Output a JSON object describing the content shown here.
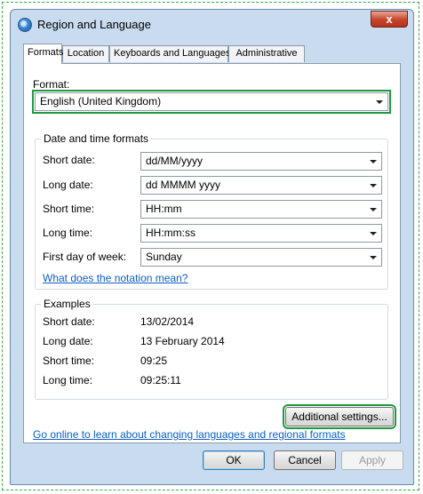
{
  "window": {
    "title": "Region and Language",
    "close_glyph": "x"
  },
  "tabs": [
    {
      "label": "Formats"
    },
    {
      "label": "Location"
    },
    {
      "label": "Keyboards and Languages"
    },
    {
      "label": "Administrative"
    }
  ],
  "format": {
    "label": "Format:",
    "value": "English (United Kingdom)"
  },
  "date_time_formats": {
    "title": "Date and time formats",
    "rows": [
      {
        "label": "Short date:",
        "value": "dd/MM/yyyy"
      },
      {
        "label": "Long date:",
        "value": "dd MMMM yyyy"
      },
      {
        "label": "Short time:",
        "value": "HH:mm"
      },
      {
        "label": "Long time:",
        "value": "HH:mm:ss"
      },
      {
        "label": "First day of week:",
        "value": "Sunday"
      }
    ],
    "notation_link": "What does the notation mean?"
  },
  "examples": {
    "title": "Examples",
    "rows": [
      {
        "label": "Short date:",
        "value": "13/02/2014"
      },
      {
        "label": "Long date:",
        "value": "13 February 2014"
      },
      {
        "label": "Short time:",
        "value": "09:25"
      },
      {
        "label": "Long time:",
        "value": "09:25:11"
      }
    ]
  },
  "additional_settings_label": "Additional settings...",
  "online_link": "Go online to learn about changing languages and regional formats",
  "buttons": {
    "ok": "OK",
    "cancel": "Cancel",
    "apply": "Apply"
  },
  "colors": {
    "highlight": "#1e9a3c",
    "link": "#0b5fc9",
    "close": "#c7432b"
  }
}
